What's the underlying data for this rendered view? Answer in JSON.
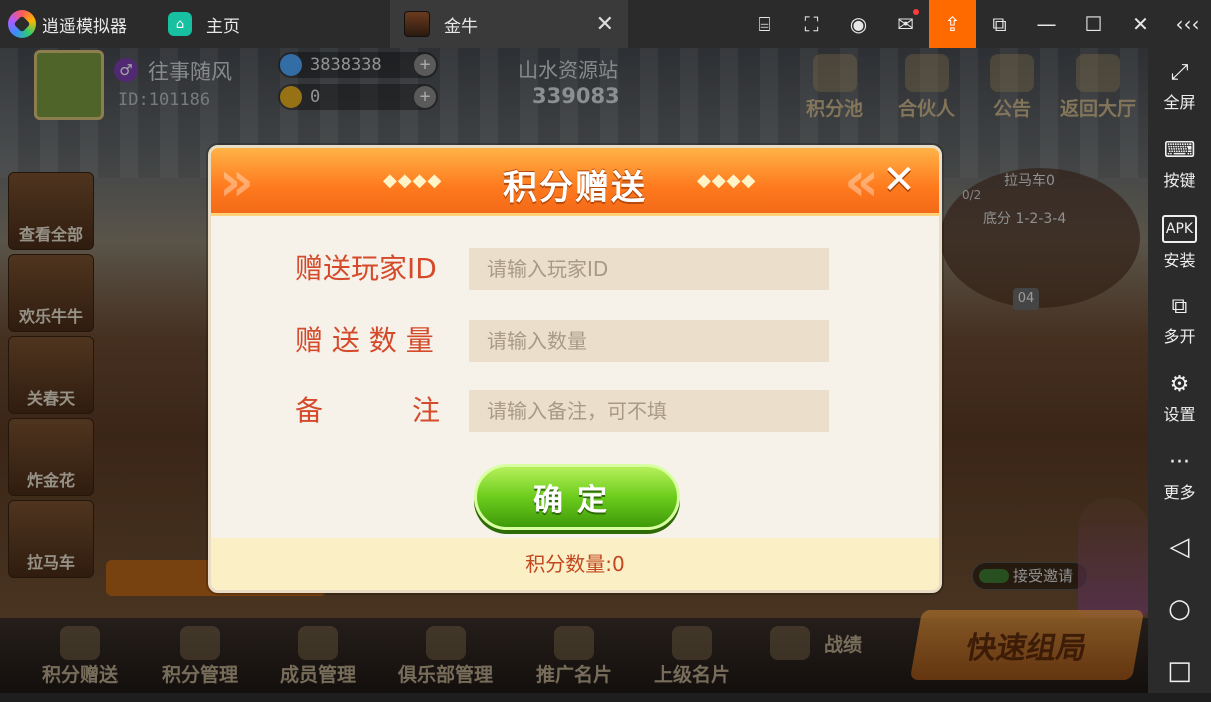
{
  "emulator": {
    "app_name": "逍遥模拟器",
    "home_tab": "主页",
    "game_tab": "金牛",
    "toolbar_icons": [
      "keyboard-map-icon",
      "screenshot-icon",
      "account-icon",
      "mail-icon",
      "upload-icon",
      "resize-icon",
      "minimize-icon",
      "maximize-icon",
      "close-icon",
      "collapse-icon"
    ]
  },
  "sidebar": {
    "items": [
      {
        "label": "全屏",
        "icon": "⤢"
      },
      {
        "label": "按键",
        "icon": "⌨"
      },
      {
        "label": "安装",
        "icon": "APK"
      },
      {
        "label": "多开",
        "icon": "⧉"
      },
      {
        "label": "设置",
        "icon": "⚙"
      },
      {
        "label": "更多",
        "icon": "···"
      }
    ],
    "nav": {
      "back": "◁",
      "home": "○",
      "recent": "□"
    }
  },
  "player": {
    "name": "往事随风",
    "id_text": "ID:101186",
    "gender_symbol": "♂",
    "diamonds": "3838338",
    "gold": "0"
  },
  "room": {
    "name": "山水资源站",
    "number": "339083"
  },
  "top_menu": [
    "积分池",
    "合伙人",
    "公告",
    "返回大厅"
  ],
  "left_games": [
    "查看全部",
    "欢乐牛牛",
    "关春天",
    "炸金花",
    "拉马车"
  ],
  "table": {
    "title": "拉马车0",
    "count": "0/2",
    "base": "底分 1-2-3-4",
    "seat": "04"
  },
  "invite_label": "接受邀请",
  "bottom_menu": [
    "积分赠送",
    "积分管理",
    "成员管理",
    "俱乐部管理",
    "推广名片",
    "上级名片",
    "战绩"
  ],
  "fast_button": "快速组局",
  "dialog": {
    "title": "积分赠送",
    "deco": "◆◆◆◆",
    "close": "✕",
    "fields": [
      {
        "label": "赠送玩家ID",
        "placeholder": "请输入玩家ID"
      },
      {
        "label": "赠 送 数 量",
        "placeholder": "请输入数量"
      },
      {
        "label": "备          注",
        "placeholder": "请输入备注，可不填"
      }
    ],
    "confirm": "确定",
    "footer": "积分数量:0"
  }
}
